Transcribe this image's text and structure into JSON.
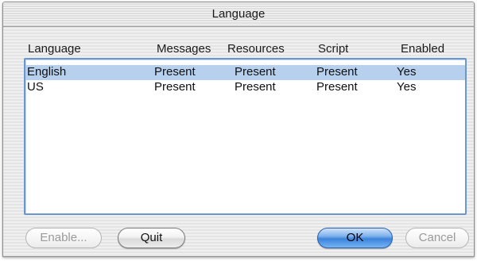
{
  "window": {
    "title": "Language"
  },
  "columns": [
    "Language",
    "Messages",
    "Resources",
    "Script",
    "Enabled"
  ],
  "rows": [
    {
      "language": "English",
      "messages": "Present",
      "resources": "Present",
      "script": "Present",
      "enabled": "Yes",
      "selected": true
    },
    {
      "language": "US",
      "messages": "Present",
      "resources": "Present",
      "script": "Present",
      "enabled": "Yes",
      "selected": false
    }
  ],
  "buttons": {
    "enable": "Enable...",
    "quit": "Quit",
    "ok": "OK",
    "cancel": "Cancel"
  },
  "colors": {
    "selection": "#b6d0ee",
    "list_border": "#6b97cf",
    "default_button": "#3b84db"
  }
}
